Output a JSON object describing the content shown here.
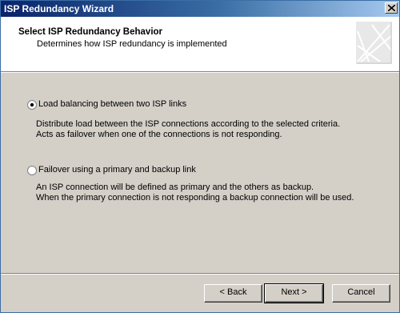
{
  "window": {
    "title": "ISP Redundancy Wizard"
  },
  "header": {
    "title": "Select ISP Redundancy Behavior",
    "subtitle": "Determines how ISP redundancy is implemented"
  },
  "options": [
    {
      "label": "Load balancing between two ISP links",
      "selected": true,
      "description": [
        "Distribute load between the ISP connections according to the selected criteria.",
        "Acts as failover when one of the connections is not responding."
      ]
    },
    {
      "label": "Failover using a primary and backup link",
      "selected": false,
      "description": [
        "An ISP connection will be defined as primary and the others as backup.",
        "When the primary connection is not responding a backup connection will be used."
      ]
    }
  ],
  "buttons": {
    "back": "< Back",
    "next": "Next >",
    "cancel": "Cancel"
  }
}
